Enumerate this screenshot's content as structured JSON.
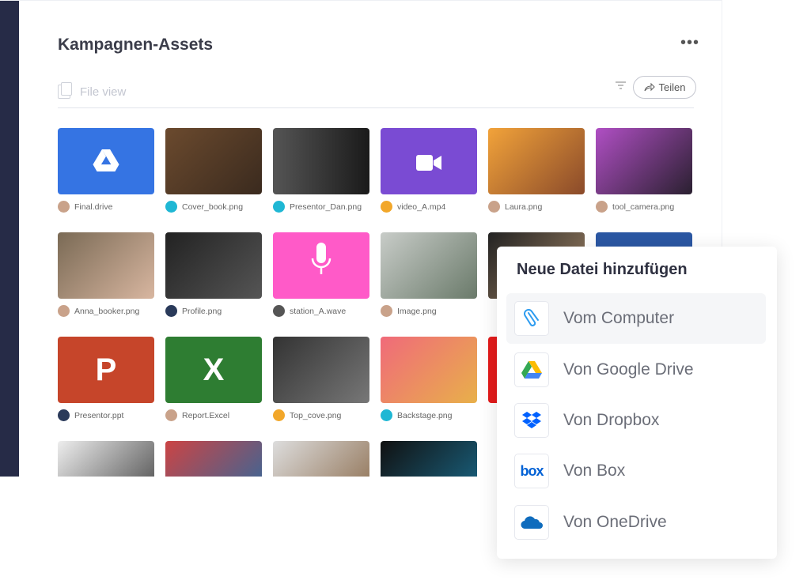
{
  "header": {
    "title": "Kampagnen-Assets",
    "more": "•••",
    "file_view": "File view",
    "share": "Teilen"
  },
  "tiles": [
    {
      "name": "Final.drive",
      "kind": "drive",
      "color": "#3574e3",
      "avatar": "#c9a28a"
    },
    {
      "name": "Cover_book.png",
      "kind": "photo",
      "color": "linear-gradient(135deg,#6b4a2e,#3a2a1e)",
      "avatar": "#1fb7d4"
    },
    {
      "name": "Presentor_Dan.png",
      "kind": "photo",
      "color": "linear-gradient(90deg,#555,#1a1a1a)",
      "avatar": "#1fb7d4"
    },
    {
      "name": "video_A.mp4",
      "kind": "video",
      "color": "#7a4bd3",
      "avatar": "#f2a72a"
    },
    {
      "name": "Laura.png",
      "kind": "photo",
      "color": "linear-gradient(135deg,#f2a33a,#8a4a2a)",
      "avatar": "#c9a28a"
    },
    {
      "name": "tool_camera.png",
      "kind": "photo",
      "color": "linear-gradient(135deg,#b04fc4,#2a2030)",
      "avatar": "#c9a28a"
    },
    {
      "name": "Anna_booker.png",
      "kind": "photo",
      "color": "linear-gradient(135deg,#7a6a55,#d8b6a0)",
      "avatar": "#c9a28a"
    },
    {
      "name": "Profile.png",
      "kind": "photo",
      "color": "linear-gradient(135deg,#222,#555)",
      "avatar": "#2a3a5a"
    },
    {
      "name": "station_A.wave",
      "kind": "mic",
      "color": "#ff5ac8",
      "avatar": "#555"
    },
    {
      "name": "Image.png",
      "kind": "photo",
      "color": "linear-gradient(135deg,#c8ccc8,#6a7a6a)",
      "avatar": "#c9a28a"
    },
    {
      "name": "",
      "kind": "photo",
      "color": "linear-gradient(135deg,#222,#a88a6a)",
      "avatar": ""
    },
    {
      "name": "",
      "kind": "photo",
      "color": "#2b57a3",
      "avatar": ""
    },
    {
      "name": "Presentor.ppt",
      "kind": "ppt",
      "color": "#c6452a",
      "avatar": "#2a3a5a"
    },
    {
      "name": "Report.Excel",
      "kind": "xls",
      "color": "#2e7d32",
      "avatar": "#c9a28a"
    },
    {
      "name": "Top_cove.png",
      "kind": "photo",
      "color": "linear-gradient(135deg,#333,#777)",
      "avatar": "#f2a72a"
    },
    {
      "name": "Backstage.png",
      "kind": "photo",
      "color": "linear-gradient(135deg,#f06a7a,#e8b04a)",
      "avatar": "#1fb7d4"
    },
    {
      "name": "",
      "kind": "photo",
      "color": "#e31b1b",
      "avatar": ""
    },
    {
      "name": "",
      "kind": "photo",
      "color": "#fff",
      "avatar": ""
    },
    {
      "name": "",
      "kind": "photo",
      "color": "linear-gradient(135deg,#eee,#444)",
      "avatar": ""
    },
    {
      "name": "",
      "kind": "photo",
      "color": "linear-gradient(135deg,#c44,#2a6aa0)",
      "avatar": ""
    },
    {
      "name": "",
      "kind": "photo",
      "color": "linear-gradient(135deg,#ddd,#8a6a4a)",
      "avatar": ""
    },
    {
      "name": "",
      "kind": "photo",
      "color": "linear-gradient(135deg,#111,#1a6a8a)",
      "avatar": ""
    }
  ],
  "tile_letters": {
    "ppt": "P",
    "xls": "X"
  },
  "popup": {
    "title": "Neue Datei hinzufügen",
    "items": [
      {
        "label": "Vom Computer",
        "icon": "paperclip-icon"
      },
      {
        "label": "Von Google Drive",
        "icon": "google-drive-icon"
      },
      {
        "label": "Von Dropbox",
        "icon": "dropbox-icon"
      },
      {
        "label": "Von Box",
        "icon": "box-icon"
      },
      {
        "label": "Von OneDrive",
        "icon": "onedrive-icon"
      }
    ]
  }
}
